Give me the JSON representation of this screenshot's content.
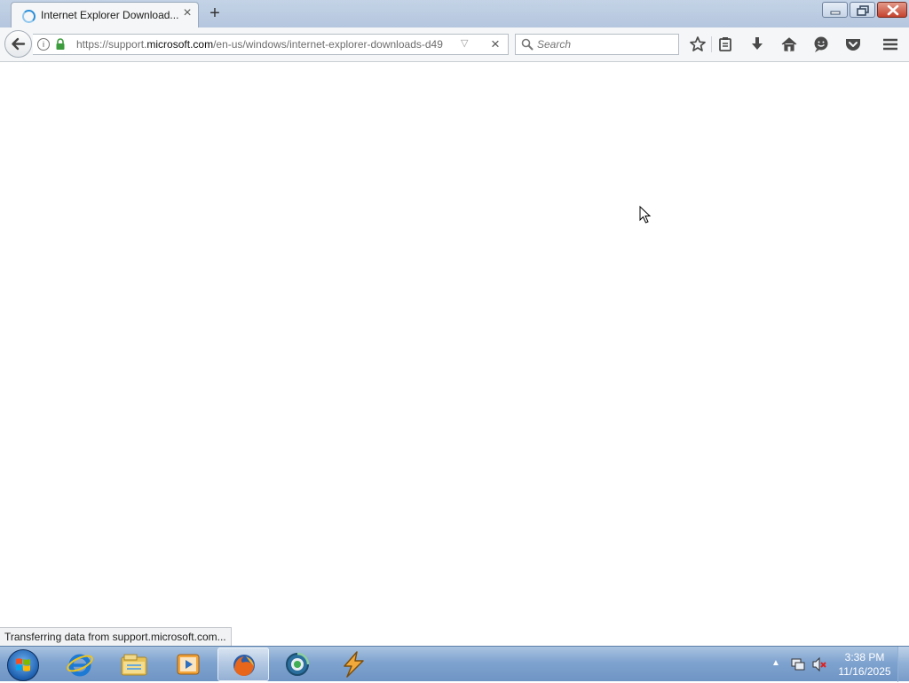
{
  "window": {
    "tab_title": "Internet Explorer Download...",
    "new_tab_label": "+",
    "tab_close_label": "×"
  },
  "navbar": {
    "url_prefix": "https://support.",
    "url_domain": "microsoft.com",
    "url_rest": "/en-us/windows/internet-explorer-downloads-d49",
    "search_placeholder": "Search",
    "stop_label": "×"
  },
  "status": {
    "text": "Transferring data from support.microsoft.com..."
  },
  "taskbar": {
    "items": [
      "start",
      "internet-explorer",
      "windows-explorer",
      "media-player",
      "firefox",
      "connectivity-app",
      "winamp"
    ],
    "clock_time": "3:38 PM",
    "clock_date": "11/16/2025"
  },
  "colors": {
    "taskbar": "#7fa3cf",
    "titlebar": "#c4d3e6",
    "toolbar": "#f5f6f7"
  }
}
